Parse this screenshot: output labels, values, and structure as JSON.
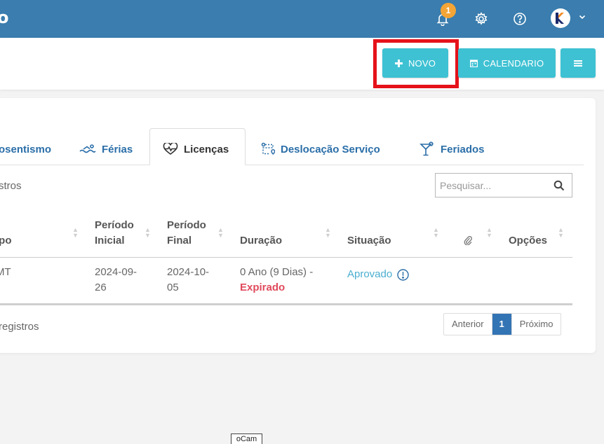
{
  "navbar": {
    "brand": "o",
    "notification_count": "1",
    "icons": [
      "bell-icon",
      "gear-icon",
      "help-icon",
      "avatar-k-logo",
      "chevron-down-icon"
    ],
    "color": "#3a7dae"
  },
  "actions": {
    "novo_label": "NOVO",
    "calendario_label": "CALENDARIO",
    "accent": "#3ec1d3",
    "highlight_color": "#e5121a"
  },
  "tabs": [
    {
      "label": "osentismo",
      "icon": ""
    },
    {
      "label": "Férias",
      "icon": "swimmer-icon"
    },
    {
      "label": "Licenças",
      "icon": "heart-pulse-icon",
      "active": true
    },
    {
      "label": "Deslocação Serviço",
      "icon": "route-icon"
    },
    {
      "label": "Feriados",
      "icon": "cocktail-icon"
    }
  ],
  "records_top": "stros",
  "search": {
    "placeholder": "Pesquisar..."
  },
  "table": {
    "headers": [
      {
        "line1": "ipo",
        "line2": ""
      },
      {
        "line1": "Período",
        "line2": "Inicial"
      },
      {
        "line1": "Período",
        "line2": "Final"
      },
      {
        "line1": "Duração",
        "line2": ""
      },
      {
        "line1": "Situação",
        "line2": ""
      },
      {
        "line1": "",
        "line2": "",
        "icon": "paperclip-icon"
      },
      {
        "line1": "Opções",
        "line2": ""
      }
    ],
    "rows": [
      {
        "tipo": "MT",
        "inicio_l1": "2024-09-",
        "inicio_l2": "26",
        "fim_l1": "2024-10-",
        "fim_l2": "05",
        "duracao": "0 Ano (9 Dias) -",
        "estado": "Expirado",
        "situacao": "Aprovado"
      }
    ]
  },
  "records_bottom": "registros",
  "pagination": {
    "prev": "Anterior",
    "page": "1",
    "next": "Próximo"
  },
  "taskbar_label": "oCam"
}
